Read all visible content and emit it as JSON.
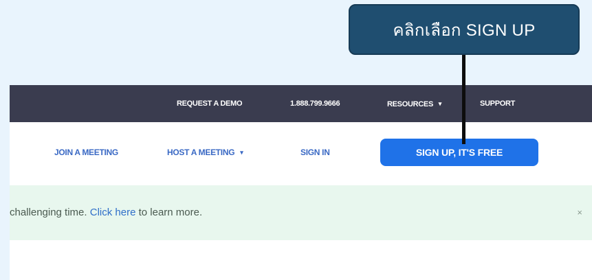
{
  "callout": {
    "text": "คลิกเลือก SIGN UP"
  },
  "topbar": {
    "request_demo": "REQUEST A DEMO",
    "phone": "1.888.799.9666",
    "resources": "RESOURCES",
    "resources_caret": "▾",
    "support": "SUPPORT"
  },
  "nav": {
    "join": "JOIN A MEETING",
    "host": "HOST A MEETING",
    "host_caret": "▾",
    "signin": "SIGN IN",
    "signup": "SIGN UP, IT'S FREE"
  },
  "notice": {
    "prefix": "challenging time. ",
    "link": "Click here",
    "suffix": " to learn more.",
    "close": "×"
  },
  "colors": {
    "page_bg": "#e9f4fd",
    "callout_bg": "#1f4e70",
    "topbar_bg": "#3a3c4f",
    "nav_link": "#3a69c4",
    "signup_bg": "#1f72e8",
    "notice_bg": "#e8f7ee",
    "notice_link": "#2f6fc9"
  },
  "icons": {
    "dropdown": "caret-down-icon",
    "close": "close-icon"
  }
}
